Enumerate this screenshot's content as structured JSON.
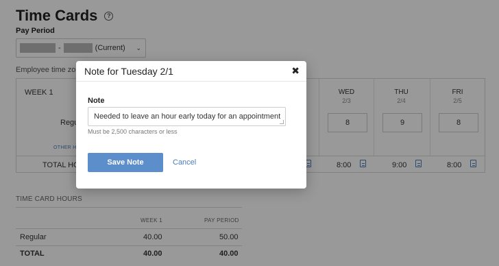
{
  "page": {
    "title": "Time Cards",
    "help_icon": "question-circle-icon",
    "pay_period_label": "Pay Period",
    "pay_period_select": {
      "separator": "-",
      "suffix": "(Current)"
    },
    "employee_timezone_label": "Employee time zone"
  },
  "grid": {
    "week_label": "WEEK 1",
    "regular_label": "Regular",
    "other_hours_label": "OTHER HO",
    "total_hours_label": "TOTAL HOU",
    "days": [
      {
        "name": "WED",
        "date": "2/3",
        "hours": "8",
        "total": "8:00"
      },
      {
        "name": "THU",
        "date": "2/4",
        "hours": "9",
        "total": "9:00"
      },
      {
        "name": "FRI",
        "date": "2/5",
        "hours": "8",
        "total": "8:00"
      }
    ]
  },
  "hours_summary": {
    "title": "TIME CARD HOURS",
    "columns": [
      "WEEK 1",
      "PAY PERIOD"
    ],
    "rows": [
      {
        "label": "Regular",
        "week": "40.00",
        "period": "50.00"
      },
      {
        "label": "TOTAL",
        "week": "40.00",
        "period": "40.00"
      }
    ]
  },
  "modal": {
    "title": "Note for Tuesday 2/1",
    "close_symbol": "✖",
    "note_label": "Note",
    "note_value": "Needed to leave an hour early today for an appointment",
    "hint": "Must be 2,500 characters or less",
    "save_label": "Save Note",
    "cancel_label": "Cancel"
  },
  "colors": {
    "accent": "#5b8ecb",
    "link": "#4a7bb7",
    "overlay": "rgba(0,0,0,0.40)"
  }
}
